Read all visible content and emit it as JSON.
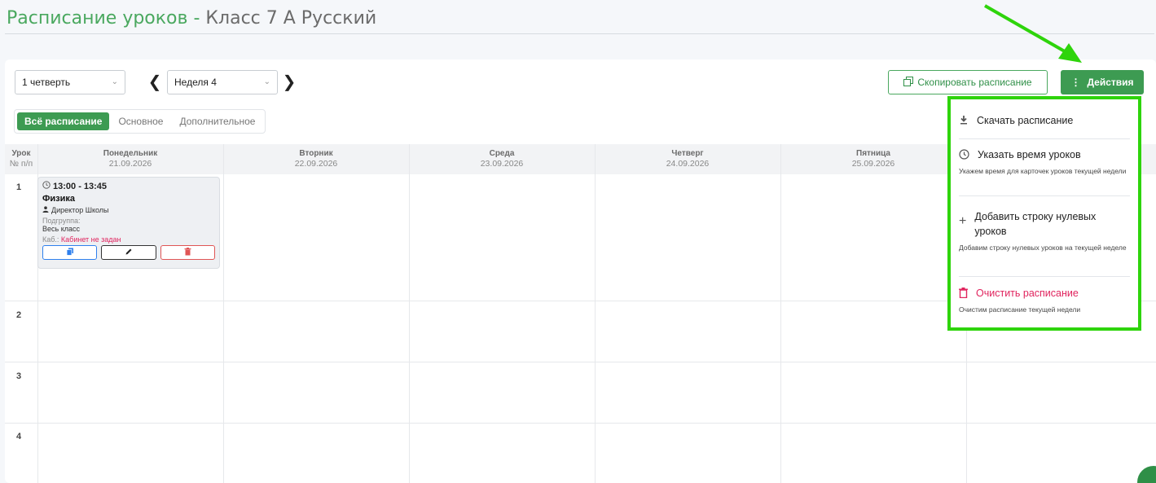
{
  "page": {
    "title_main": "Расписание уроков",
    "title_sep": " - ",
    "title_class": "Класс 7 А Русский"
  },
  "toolbar": {
    "quarter_value": "1 четверть",
    "week_value": "Неделя 4",
    "prev_icon": "chevron-left-icon",
    "next_icon": "chevron-right-icon",
    "copy_label": "Скопировать расписание",
    "actions_label": "Действия"
  },
  "tabs": [
    {
      "label": "Всё расписание",
      "active": true
    },
    {
      "label": "Основное",
      "active": false
    },
    {
      "label": "Дополнительное",
      "active": false
    }
  ],
  "grid": {
    "lesson_col_label1": "Урок",
    "lesson_col_label2": "№ п/п",
    "days": [
      {
        "name": "Понедельник",
        "date": "21.09.2026"
      },
      {
        "name": "Вторник",
        "date": "22.09.2026"
      },
      {
        "name": "Среда",
        "date": "23.09.2026"
      },
      {
        "name": "Четверг",
        "date": "24.09.2026"
      },
      {
        "name": "Пятница",
        "date": "25.09.2026"
      }
    ],
    "rows": [
      "1",
      "2",
      "3",
      "4"
    ]
  },
  "lesson_card": {
    "time": "13:00 - 13:45",
    "subject": "Физика",
    "teacher": "Директор Школы",
    "subgroup_label": "Подгруппа:",
    "subgroup_value": "Весь класс",
    "room_label": "Каб.:",
    "room_value": "Кабинет не задан"
  },
  "actions_menu": {
    "download": {
      "label": "Скачать расписание"
    },
    "set_time": {
      "label": "Указать время уроков",
      "desc": "Укажем время для карточек уроков текущей недели"
    },
    "add_zero": {
      "label": "Добавить строку нулевых уроков",
      "desc": "Добавим строку нулевых уроков на текущей неделе"
    },
    "clear": {
      "label": "Очистить расписание",
      "desc": "Очистим расписание текущей недели"
    }
  },
  "colors": {
    "accent_green": "#3d9b52",
    "highlight_green": "#2ed40b",
    "danger": "#e0245e"
  }
}
